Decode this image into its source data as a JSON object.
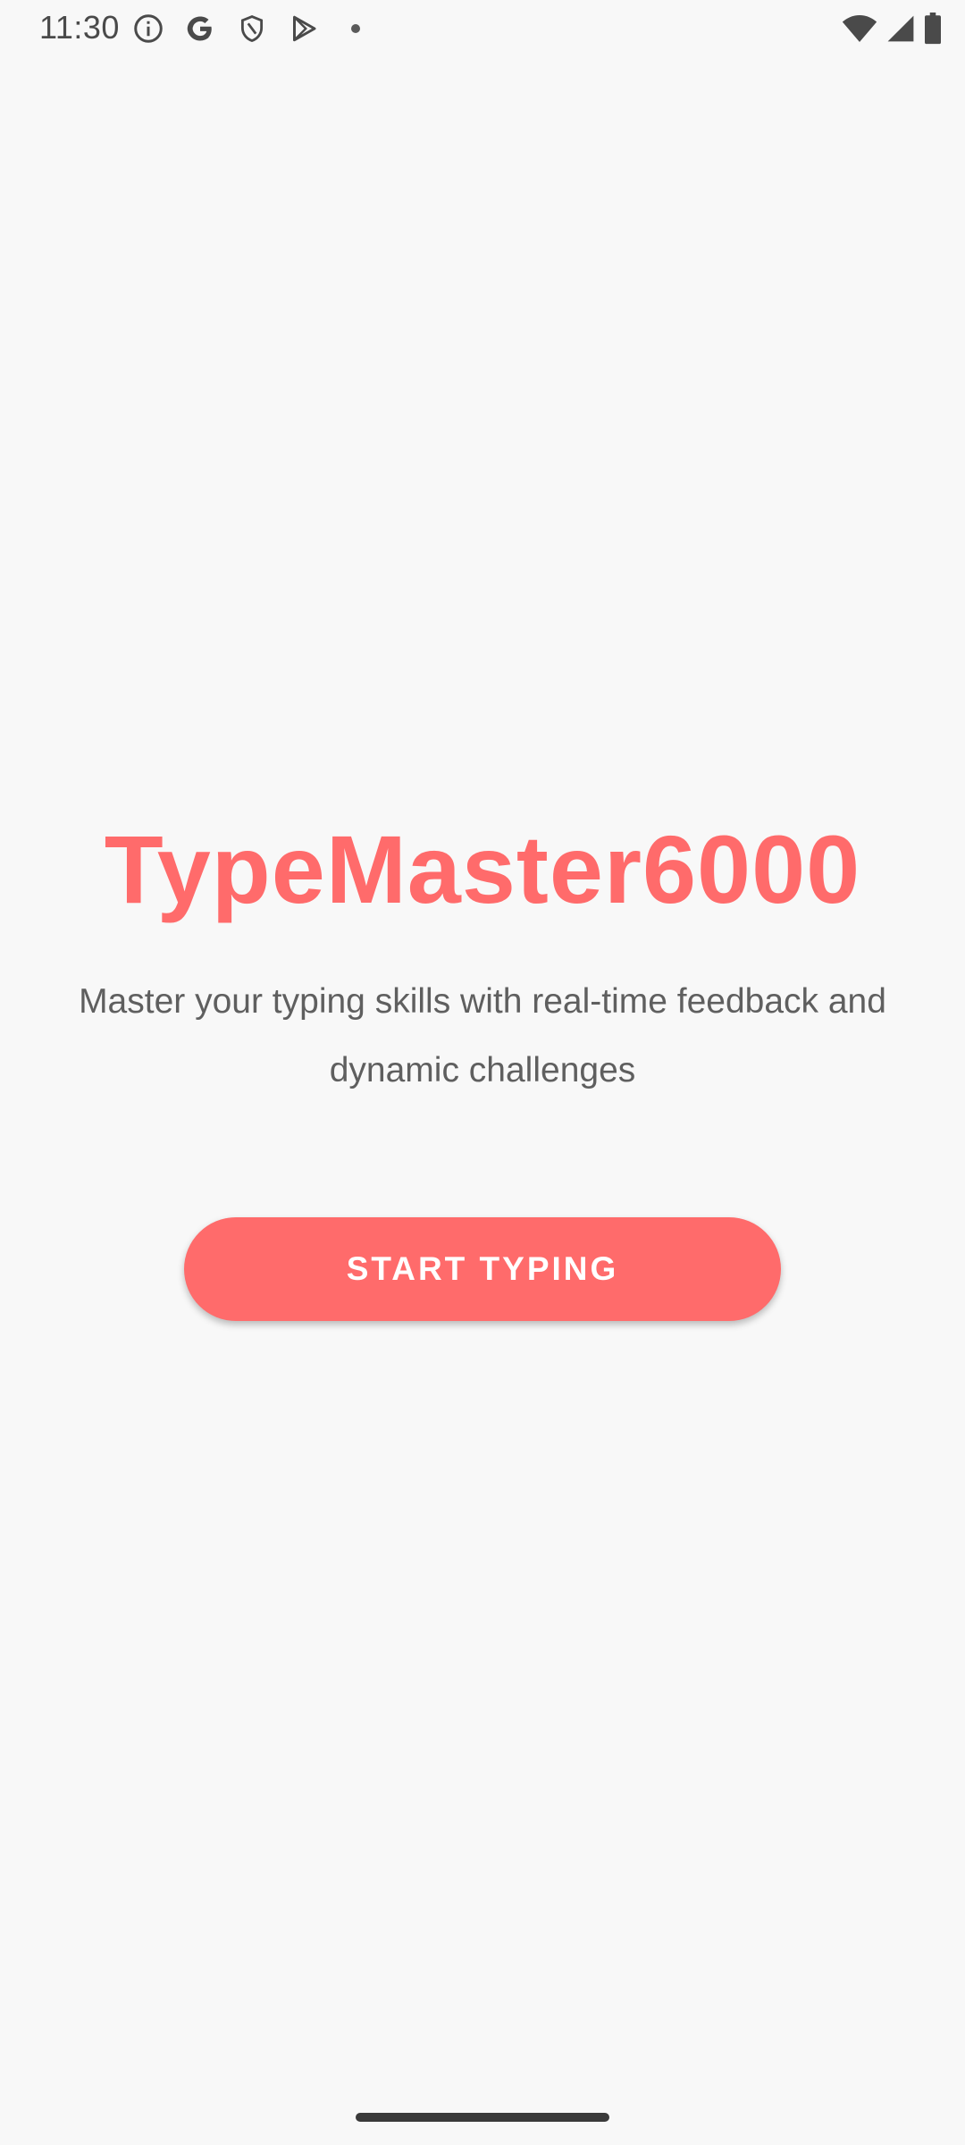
{
  "status_bar": {
    "time": "11:30",
    "left_icons": [
      "info-icon",
      "google-icon",
      "shield-icon",
      "play-store-icon",
      "dot-icon"
    ],
    "right_icons": [
      "wifi-icon",
      "signal-icon",
      "battery-icon"
    ]
  },
  "main": {
    "title": "TypeMaster6000",
    "subtitle": "Master your typing skills with real-time feedback and dynamic challenges",
    "start_button_label": "START TYPING"
  },
  "colors": {
    "accent": "#ff6b6b",
    "background": "#f8f8f8",
    "subtitle_text": "#5f5f5f"
  }
}
